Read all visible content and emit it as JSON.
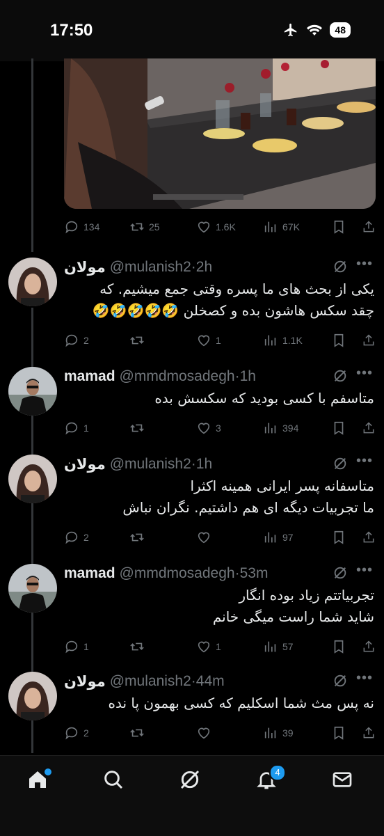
{
  "status_bar": {
    "time": "17:50",
    "battery": "48",
    "icons": [
      "airplane-icon",
      "wifi-icon",
      "battery-icon"
    ]
  },
  "main_tweet": {
    "image": {
      "description_icon": "photo"
    },
    "stats": {
      "replies": "134",
      "reposts": "25",
      "likes": "1.6K",
      "views": "67K"
    }
  },
  "replies": [
    {
      "name": "مولان",
      "handle": "@mulanish2",
      "time": "2h",
      "lines": [
        "یکی از بحث های ما پسره وقتی جمع میشیم. که",
        "چقد سکس هاشون بده و کصخلن 🤣🤣🤣🤣🤣"
      ],
      "stats": {
        "replies": "2",
        "reposts": "",
        "likes": "1",
        "views": "1.1K"
      }
    },
    {
      "name": "mamad",
      "handle": "@mmdmosadegh",
      "time": "1h",
      "lines": [
        "متاسفم با کسی بودید که سکسش بده"
      ],
      "stats": {
        "replies": "1",
        "reposts": "",
        "likes": "3",
        "views": "394"
      }
    },
    {
      "name": "مولان",
      "handle": "@mulanish2",
      "time": "1h",
      "lines": [
        "متاسفانه پسر ایرانی همینه اکثرا",
        "ما تجربیات دیگه ای هم داشتیم. نگران نباش"
      ],
      "stats": {
        "replies": "2",
        "reposts": "",
        "likes": "",
        "views": "97"
      }
    },
    {
      "name": "mamad",
      "handle": "@mmdmosadegh",
      "time": "53m",
      "lines": [
        "تجربیاتتم زیاد بوده انگار",
        "شاید شما راست میگی خانم"
      ],
      "stats": {
        "replies": "1",
        "reposts": "",
        "likes": "1",
        "views": "57"
      }
    },
    {
      "name": "مولان",
      "handle": "@mulanish2",
      "time": "44m",
      "lines": [
        "نه پس مث شما اسکلیم که کسی بهمون پا نده"
      ],
      "stats": {
        "replies": "2",
        "reposts": "",
        "likes": "",
        "views": "39"
      }
    }
  ],
  "tab_bar": {
    "notifications_badge": "4",
    "tabs": [
      "home-icon",
      "search-icon",
      "grok-icon",
      "notifications-icon",
      "messages-icon"
    ]
  },
  "colors": {
    "background": "#000000",
    "text": "#e7e9ea",
    "muted": "#71767b",
    "accent": "#1d9bf0"
  }
}
